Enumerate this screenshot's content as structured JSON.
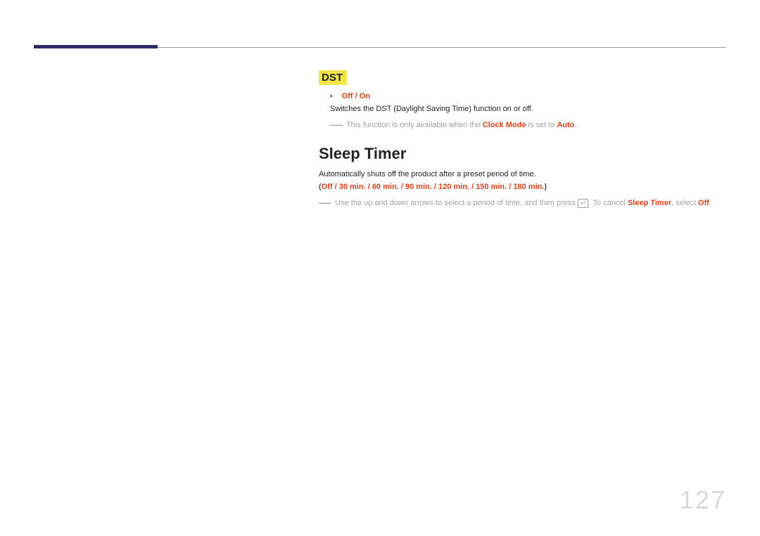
{
  "dst": {
    "heading": "DST",
    "option_off": "Off",
    "option_on": "On",
    "slash": " / ",
    "description": "Switches the DST (Daylight Saving Time) function on or off.",
    "note_prefix": "This function is only available when the ",
    "note_clockmode": "Clock Mode",
    "note_mid": " is set to ",
    "note_auto": "Auto",
    "note_period": "."
  },
  "sleep": {
    "heading": "Sleep Timer",
    "description": "Automatically shuts off the product after a preset period of time.",
    "open_paren": "(",
    "opt_off": "Off",
    "opt_30": "30 min.",
    "opt_60": "60 min.",
    "opt_90": "90 min.",
    "opt_120": "120 min.",
    "opt_150": "150 min.",
    "opt_180": "180 min.",
    "slash": " / ",
    "close_paren": ")",
    "note_prefix": "Use the up and down arrows to select a period of time, and then press ",
    "enter_icon": "↵",
    "note_mid": ". To cancel ",
    "note_sleeptimer": "Sleep Timer",
    "note_select": ", select ",
    "note_off": "Off",
    "note_period": "."
  },
  "page_number": "127"
}
